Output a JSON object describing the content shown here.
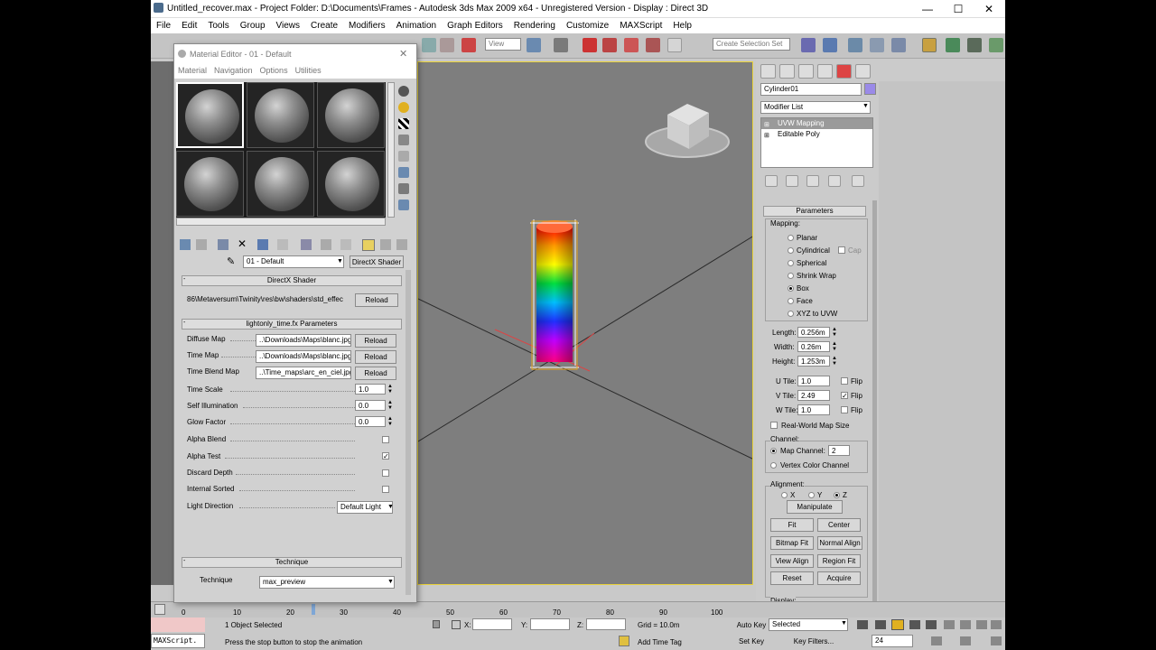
{
  "window": {
    "title": "Untitled_recover.max      - Project Folder: D:\\Documents\\Frames      - Autodesk 3ds Max  2009 x64    - Unregistered Version      - Display : Direct 3D",
    "minimize": "—",
    "maximize": "☐",
    "close": "✕"
  },
  "menu": [
    "File",
    "Edit",
    "Tools",
    "Group",
    "Views",
    "Create",
    "Modifiers",
    "Animation",
    "Graph Editors",
    "Rendering",
    "Customize",
    "MAXScript",
    "Help"
  ],
  "toolbar": {
    "view_dropdown": "View",
    "selection_set": "Create Selection Set"
  },
  "material_editor": {
    "title": "Material Editor - 01 - Default",
    "menu": [
      "Material",
      "Navigation",
      "Options",
      "Utilities"
    ],
    "material_name": "01 - Default",
    "material_type": "DirectX Shader",
    "shader_rollout": "DirectX Shader",
    "shader_path": "86\\Metaversum\\Twinity\\res\\bw\\shaders\\std_effec",
    "reload": "Reload",
    "params_rollout": "lightonly_time.fx Parameters",
    "params": [
      {
        "label": "Diffuse Map",
        "value": "..\\Downloads\\Maps\\blanc.jpg"
      },
      {
        "label": "Time Map",
        "value": "..\\Downloads\\Maps\\blanc.jpg"
      },
      {
        "label": "Time Blend Map",
        "value": "..\\Time_maps\\arc_en_ciel.jpg"
      }
    ],
    "numeric": [
      {
        "label": "Time Scale",
        "value": "1.0"
      },
      {
        "label": "Self Illumination",
        "value": "0.0"
      },
      {
        "label": "Glow Factor",
        "value": "0.0"
      }
    ],
    "checks": [
      {
        "label": "Alpha Blend",
        "checked": false
      },
      {
        "label": "Alpha Test",
        "checked": true
      },
      {
        "label": "Discard Depth",
        "checked": false
      },
      {
        "label": "Internal Sorted",
        "checked": false
      }
    ],
    "light_direction_label": "Light Direction",
    "light_direction_value": "Default Light",
    "technique_rollout": "Technique",
    "technique_label": "Technique",
    "technique_value": "max_preview"
  },
  "command_panel": {
    "object_name": "Cylinder01",
    "modifier_list": "Modifier List",
    "stack": [
      "UVW Mapping",
      "Editable Poly"
    ],
    "parameters_title": "Parameters",
    "mapping_label": "Mapping:",
    "mapping_options": [
      "Planar",
      "Cylindrical",
      "Spherical",
      "Shrink Wrap",
      "Box",
      "Face",
      "XYZ to UVW"
    ],
    "cap_label": "Cap",
    "length_label": "Length:",
    "length_value": "0.256m",
    "width_label": "Width:",
    "width_value": "0.26m",
    "height_label": "Height:",
    "height_value": "1.253m",
    "u_tile_label": "U Tile:",
    "u_tile_value": "1.0",
    "v_tile_label": "V Tile:",
    "v_tile_value": "2.49",
    "w_tile_label": "W Tile:",
    "w_tile_value": "1.0",
    "flip_label": "Flip",
    "real_world": "Real-World Map Size",
    "channel_label": "Channel:",
    "map_channel_label": "Map Channel:",
    "map_channel_value": "2",
    "vertex_color": "Vertex Color Channel",
    "alignment_label": "Alignment:",
    "axis_x": "X",
    "axis_y": "Y",
    "axis_z": "Z",
    "manipulate": "Manipulate",
    "fit": "Fit",
    "center": "Center",
    "bitmap_fit": "Bitmap Fit",
    "normal_align": "Normal Align",
    "view_align": "View Align",
    "region_fit": "Region Fit",
    "reset": "Reset",
    "acquire": "Acquire",
    "display_label": "Display:"
  },
  "timeline": {
    "ticks": [
      "0",
      "10",
      "20",
      "30",
      "40",
      "50",
      "60",
      "70",
      "80",
      "90",
      "100"
    ]
  },
  "status": {
    "selection": "1 Object Selected",
    "x_label": "X:",
    "y_label": "Y:",
    "z_label": "Z:",
    "grid": "Grid = 10.0m",
    "auto_key": "Auto Key",
    "auto_key_mode": "Selected",
    "set_key": "Set Key",
    "key_filters": "Key Filters...",
    "frame": "24",
    "maxscript": "MAXScript.",
    "prompt": "Press the stop button to stop the animation",
    "add_time_tag": "Add Time Tag"
  },
  "colors": {
    "viewport_bg": "#7e7e7e",
    "viewport_border": "#e9d23a",
    "selection_accent": "#9a9a9a"
  }
}
